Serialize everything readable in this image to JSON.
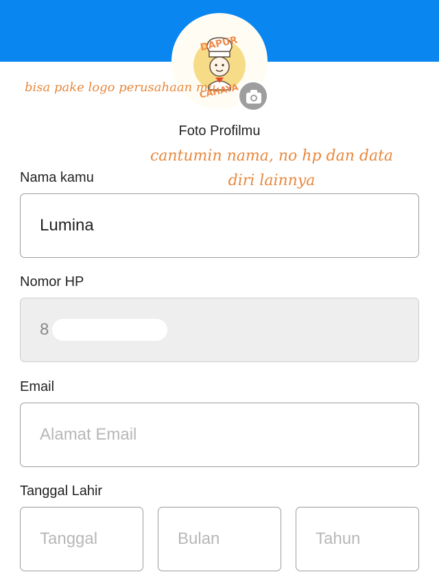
{
  "header": {
    "color": "#0a86f0"
  },
  "profile": {
    "avatar_logo": {
      "line1": "DAPUR",
      "line2": "CAHAYA",
      "color": "#f08a4b"
    },
    "camera_icon": "camera-icon",
    "photo_label": "Foto Profilmu"
  },
  "annotations": {
    "logo_note": "bisa pake logo perusahaan mu",
    "data_note": "cantumin nama, no hp dan data diri lainnya"
  },
  "form": {
    "name": {
      "label": "Nama kamu",
      "value": "Lumina"
    },
    "phone": {
      "label": "Nomor HP",
      "value": "8"
    },
    "email": {
      "label": "Email",
      "placeholder": "Alamat Email"
    },
    "birthdate": {
      "label": "Tanggal Lahir",
      "day_placeholder": "Tanggal",
      "month_placeholder": "Bulan",
      "year_placeholder": "Tahun"
    }
  }
}
